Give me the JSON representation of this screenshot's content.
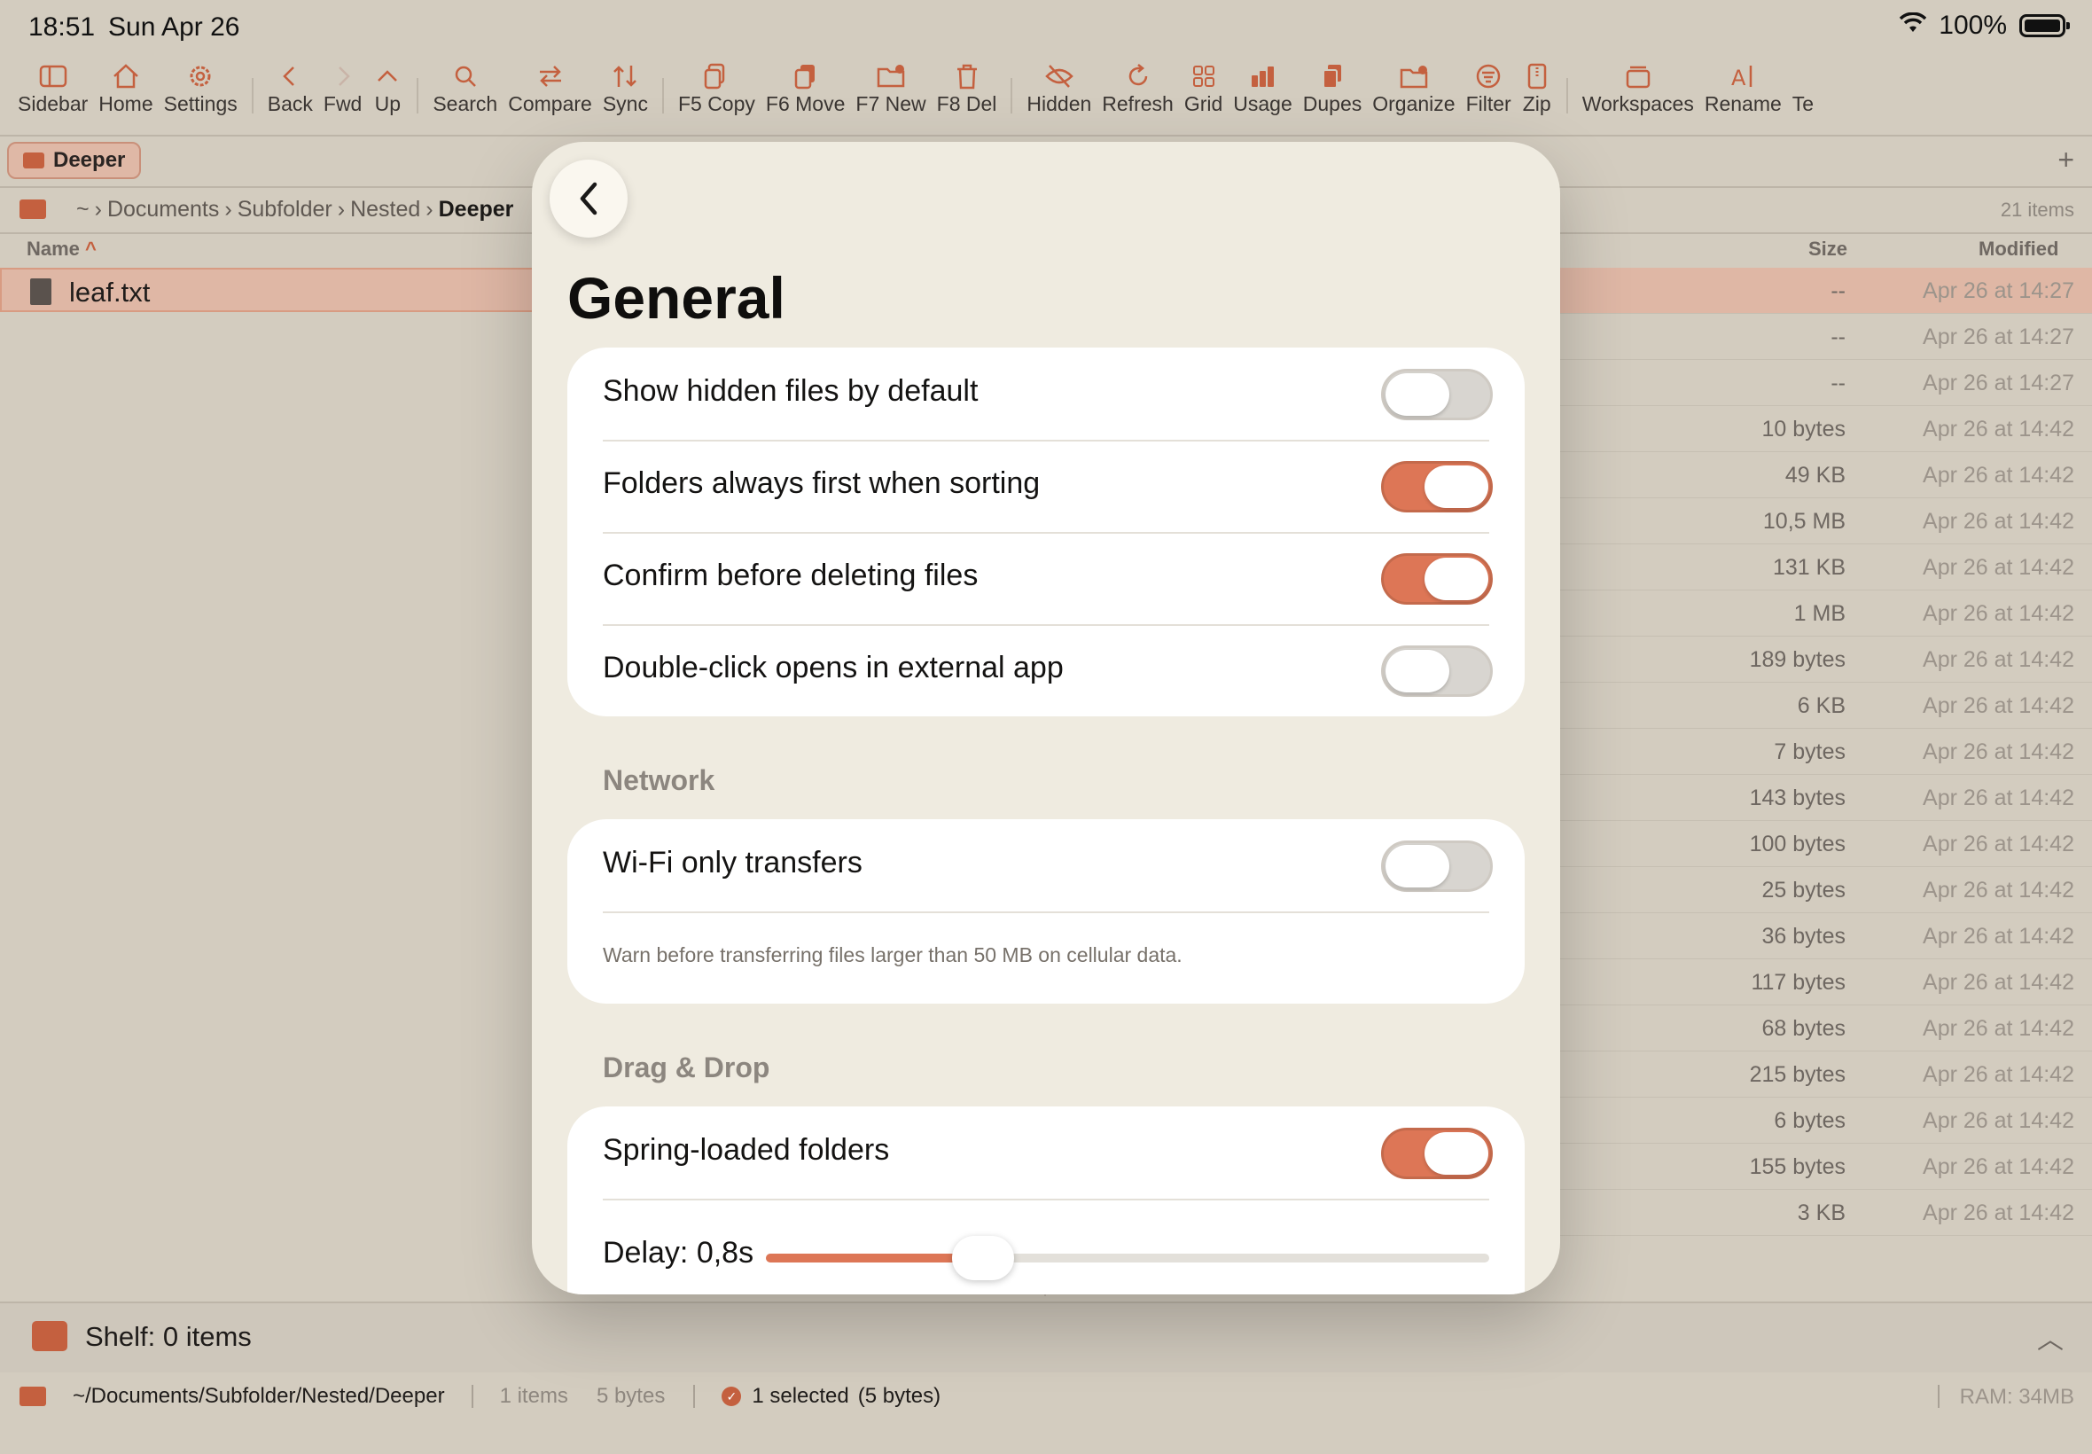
{
  "status_bar": {
    "time": "18:51",
    "date": "Sun Apr 26",
    "battery": "100%"
  },
  "toolbar": [
    {
      "label": "Sidebar",
      "icon": "sidebar-icon"
    },
    {
      "label": "Home",
      "icon": "home-icon"
    },
    {
      "label": "Settings",
      "icon": "gear-icon"
    },
    {
      "label": "Back",
      "icon": "chevron-left-icon"
    },
    {
      "label": "Fwd",
      "icon": "chevron-right-icon"
    },
    {
      "label": "Up",
      "icon": "chevron-up-icon"
    },
    {
      "label": "Search",
      "icon": "search-icon"
    },
    {
      "label": "Compare",
      "icon": "compare-arrows-icon"
    },
    {
      "label": "Sync",
      "icon": "sync-icon"
    },
    {
      "label": "F5 Copy",
      "icon": "copy-icon"
    },
    {
      "label": "F6 Move",
      "icon": "move-icon"
    },
    {
      "label": "F7 New",
      "icon": "new-folder-icon"
    },
    {
      "label": "F8 Del",
      "icon": "trash-icon"
    },
    {
      "label": "Hidden",
      "icon": "eye-slash-icon"
    },
    {
      "label": "Refresh",
      "icon": "refresh-icon"
    },
    {
      "label": "Grid",
      "icon": "grid-icon"
    },
    {
      "label": "Usage",
      "icon": "bar-chart-icon"
    },
    {
      "label": "Dupes",
      "icon": "duplicate-icon"
    },
    {
      "label": "Organize",
      "icon": "organize-folder-icon"
    },
    {
      "label": "Filter",
      "icon": "filter-icon"
    },
    {
      "label": "Zip",
      "icon": "zip-icon"
    },
    {
      "label": "Workspaces",
      "icon": "workspaces-icon"
    },
    {
      "label": "Rename",
      "icon": "rename-icon"
    },
    {
      "label": "Te",
      "icon": ""
    }
  ],
  "tabs": {
    "active": "Deeper"
  },
  "path": {
    "crumbs": [
      "~",
      "Documents",
      "Subfolder",
      "Nested",
      "Deeper"
    ],
    "item_count": "21 items"
  },
  "columns": {
    "name": "Name",
    "size": "Size",
    "modified": "Modified"
  },
  "left_pane": {
    "selected_file": "leaf.txt"
  },
  "files": [
    {
      "size": "--",
      "modified": "Apr 26 at 14:27"
    },
    {
      "size": "--",
      "modified": "Apr 26 at 14:27"
    },
    {
      "size": "--",
      "modified": "Apr 26 at 14:27"
    },
    {
      "size": "10 bytes",
      "modified": "Apr 26 at 14:42"
    },
    {
      "size": "49 KB",
      "modified": "Apr 26 at 14:42"
    },
    {
      "size": "10,5 MB",
      "modified": "Apr 26 at 14:42"
    },
    {
      "size": "131 KB",
      "modified": "Apr 26 at 14:42"
    },
    {
      "size": "1 MB",
      "modified": "Apr 26 at 14:42"
    },
    {
      "size": "189 bytes",
      "modified": "Apr 26 at 14:42"
    },
    {
      "size": "6 KB",
      "modified": "Apr 26 at 14:42"
    },
    {
      "size": "7 bytes",
      "modified": "Apr 26 at 14:42"
    },
    {
      "size": "143 bytes",
      "modified": "Apr 26 at 14:42"
    },
    {
      "size": "100 bytes",
      "modified": "Apr 26 at 14:42"
    },
    {
      "size": "25 bytes",
      "modified": "Apr 26 at 14:42"
    },
    {
      "size": "36 bytes",
      "modified": "Apr 26 at 14:42"
    },
    {
      "size": "117 bytes",
      "modified": "Apr 26 at 14:42"
    },
    {
      "size": "68 bytes",
      "modified": "Apr 26 at 14:42"
    },
    {
      "size": "215 bytes",
      "modified": "Apr 26 at 14:42"
    },
    {
      "size": "6 bytes",
      "modified": "Apr 26 at 14:42"
    },
    {
      "size": "155 bytes",
      "modified": "Apr 26 at 14:42"
    },
    {
      "size": "3 KB",
      "modified": "Apr 26 at 14:42"
    }
  ],
  "shelf": {
    "label": "Shelf: 0 items"
  },
  "bottom_bar": {
    "path": "~/Documents/Subfolder/Nested/Deeper",
    "items": "1 items",
    "size": "5 bytes",
    "selected": "1 selected",
    "selected_size": "(5 bytes)",
    "ram": "RAM: 34MB"
  },
  "sheet": {
    "title": "General",
    "general": [
      {
        "label": "Show hidden files by default",
        "on": false
      },
      {
        "label": "Folders always first when sorting",
        "on": true
      },
      {
        "label": "Confirm before deleting files",
        "on": true
      },
      {
        "label": "Double-click opens in external app",
        "on": false
      }
    ],
    "network": {
      "header": "Network",
      "label": "Wi-Fi only transfers",
      "on": false,
      "note": "Warn before transferring files larger than 50 MB on cellular data."
    },
    "drag_drop": {
      "header": "Drag & Drop",
      "label": "Spring-loaded folders",
      "on": true,
      "delay_label": "Delay: 0,8s",
      "delay_fraction": 0.3
    }
  },
  "colors": {
    "accent": "#dd7656",
    "toggle_off": "#d8d5d0",
    "sheet_bg": "#efebe0"
  }
}
